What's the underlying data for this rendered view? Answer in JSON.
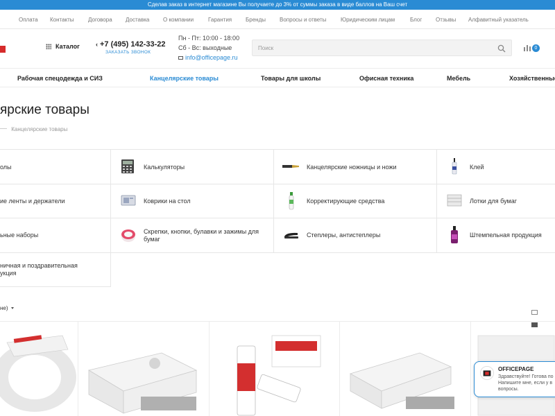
{
  "promo": {
    "text": "Сделав заказ в интернет магазине Вы получаете до 3% от суммы заказа в виде баллов на Ваш счет"
  },
  "topnav": [
    "Оплата",
    "Контакты",
    "Договора",
    "Доставка",
    "О компании",
    "Гарантия",
    "Бренды",
    "Вопросы и ответы",
    "Юридическим лицам",
    "Блог",
    "Отзывы",
    "Алфавитный указатель"
  ],
  "header": {
    "catalog_label": "Каталог",
    "phone": "+7 (495) 142-33-22",
    "callback": "ЗАКАЗАТЬ ЗВОНОК",
    "hours_weekday": "Пн - Пт: 10:00 - 18:00",
    "hours_weekend": "Сб - Вс: выходные",
    "email": "info@officepage.ru",
    "search_placeholder": "Поиск",
    "compare_count": "0"
  },
  "catnav": [
    {
      "label": "Рабочая спецодежда и СИЗ",
      "active": false
    },
    {
      "label": "Канцелярские товары",
      "active": true
    },
    {
      "label": "Товары для школы",
      "active": false
    },
    {
      "label": "Офисная техника",
      "active": false
    },
    {
      "label": "Мебель",
      "active": false
    },
    {
      "label": "Хозяйственные",
      "active": false
    }
  ],
  "page": {
    "title": "ярские товары",
    "breadcrumb_home": "",
    "breadcrumb_current": "Канцелярские товары"
  },
  "categories": [
    {
      "label": "олы",
      "icon": ""
    },
    {
      "label": "Калькуляторы",
      "icon": "calculator-icon"
    },
    {
      "label": "Канцелярские ножницы и ножи",
      "icon": "knife-icon"
    },
    {
      "label": "Клей",
      "icon": "glue-icon"
    },
    {
      "label": "ие ленты и держатели",
      "icon": ""
    },
    {
      "label": "Коврики на стол",
      "icon": "desk-mat-icon"
    },
    {
      "label": "Корректирующие средства",
      "icon": "corrector-icon"
    },
    {
      "label": "Лотки для бумаг",
      "icon": "paper-tray-icon"
    },
    {
      "label": "ьные наборы",
      "icon": ""
    },
    {
      "label": "Скрепки, кнопки, булавки и зажимы для бумаг",
      "icon": "paperclips-icon"
    },
    {
      "label": "Степлеры, антистеплеры",
      "icon": "stapler-icon"
    },
    {
      "label": "Штемпельная продукция",
      "icon": "stamp-ink-icon"
    },
    {
      "label": "ничная и поздравительная укция",
      "icon": ""
    }
  ],
  "sort": {
    "label": "не)"
  },
  "chat": {
    "name": "OFFICEPAGE",
    "message": "Здравствуйте! Готова по Напишите мне, если у в вопросы."
  },
  "colors": {
    "accent": "#2a8bd4",
    "brand_red": "#d62b2b"
  }
}
